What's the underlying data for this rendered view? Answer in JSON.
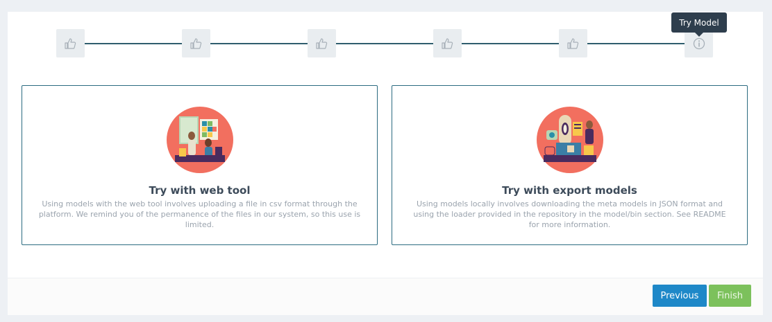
{
  "wizard": {
    "steps": [
      {
        "icon": "thumbs-up-icon"
      },
      {
        "icon": "thumbs-up-icon"
      },
      {
        "icon": "thumbs-up-icon"
      },
      {
        "icon": "thumbs-up-icon"
      },
      {
        "icon": "thumbs-up-icon"
      },
      {
        "icon": "info-icon"
      }
    ],
    "active_tooltip": "Try Model",
    "colors": {
      "line": "#2f5d6e",
      "card_border": "#2b6b80",
      "tooltip_bg": "#2e3e4d"
    }
  },
  "options": [
    {
      "title": "Try with web tool",
      "description": "Using models with the web tool involves uploading a file in csv format through the platform. We remind you of the permanence of the files in our system, so this use is limited.",
      "illustration": "people-with-puzzle-board-illustration"
    },
    {
      "title": "Try with export models",
      "description": "Using models locally involves downloading the meta models in JSON format and using the loader provided in the repository in the model/bin section. See README for more information.",
      "illustration": "machine-with-worker-illustration"
    }
  ],
  "footer": {
    "previous_label": "Previous",
    "finish_label": "Finish",
    "colors": {
      "previous": "#1e88c8",
      "finish": "#7cc15c"
    }
  }
}
